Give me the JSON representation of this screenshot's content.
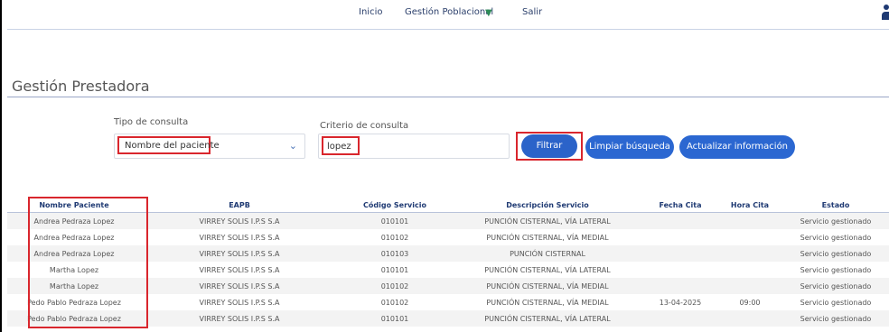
{
  "nav": {
    "inicio": "Inicio",
    "gestion": "Gestión Poblacional",
    "salir": "Salir"
  },
  "page": {
    "title": "Gestión Prestadora"
  },
  "filters": {
    "tipo_label": "Tipo de consulta",
    "tipo_value": "Nombre del paciente",
    "criterio_label": "Criterio de consulta",
    "criterio_value": "lopez"
  },
  "buttons": {
    "filtrar": "Filtrar",
    "limpiar": "Limpiar búsqueda",
    "actualizar": "Actualizar información"
  },
  "table": {
    "headers": [
      "Nombre Paciente",
      "EAPB",
      "Código Servicio",
      "Descripción Servicio",
      "Fecha Cita",
      "Hora Cita",
      "Estado"
    ],
    "rows": [
      [
        "Andrea Pedraza Lopez",
        "VIRREY SOLIS I.P.S S.A",
        "010101",
        "PUNCIÓN CISTERNAL, VÍA LATERAL",
        "",
        "",
        "Servicio gestionado"
      ],
      [
        "Andrea Pedraza Lopez",
        "VIRREY SOLIS I.P.S S.A",
        "010102",
        "PUNCIÓN CISTERNAL, VÍA MEDIAL",
        "",
        "",
        "Servicio gestionado"
      ],
      [
        "Andrea Pedraza Lopez",
        "VIRREY SOLIS I.P.S S.A",
        "010103",
        "PUNCIÓN CISTERNAL",
        "",
        "",
        "Servicio gestionado"
      ],
      [
        "Martha Lopez",
        "VIRREY SOLIS I.P.S S.A",
        "010101",
        "PUNCIÓN CISTERNAL, VÍA LATERAL",
        "",
        "",
        "Servicio gestionado"
      ],
      [
        "Martha Lopez",
        "VIRREY SOLIS I.P.S S.A",
        "010102",
        "PUNCIÓN CISTERNAL, VÍA MEDIAL",
        "",
        "",
        "Servicio gestionado"
      ],
      [
        "Pedo Pablo Pedraza Lopez",
        "VIRREY SOLIS I.P.S S.A",
        "010102",
        "PUNCIÓN CISTERNAL, VÍA MEDIAL",
        "13-04-2025",
        "09:00",
        "Servicio gestionado"
      ],
      [
        "Pedo Pablo Pedraza Lopez",
        "VIRREY SOLIS I.P.S S.A",
        "010101",
        "PUNCIÓN CISTERNAL, VÍA LATERAL",
        "",
        "",
        "Servicio gestionado"
      ]
    ]
  },
  "icons": {
    "dropdown": "chevron-down-icon",
    "nav_caret": "caret-down-icon",
    "user": "user-icon"
  },
  "colors": {
    "primary_button": "#2b67d1",
    "highlight": "#d9262d",
    "header_text": "#1f3a73"
  }
}
